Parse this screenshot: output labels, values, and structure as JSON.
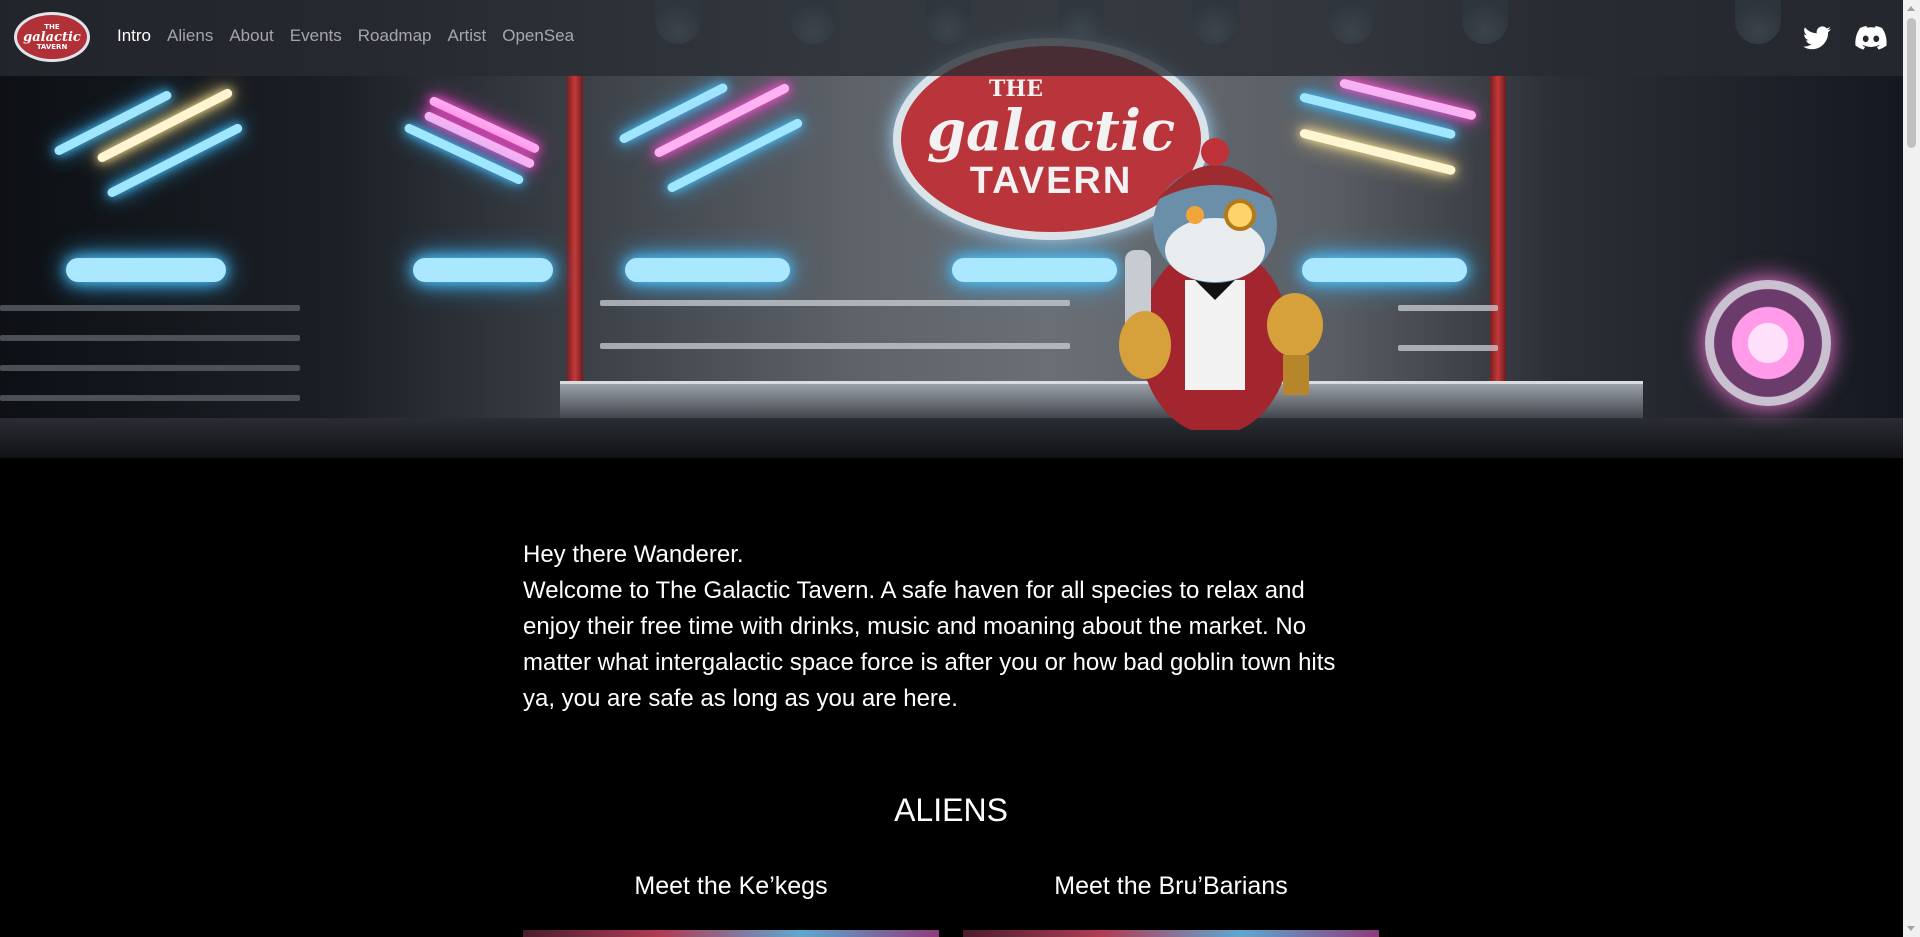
{
  "logo": {
    "line1": "THE",
    "line2": "galactic",
    "line3": "TAVERN"
  },
  "nav": {
    "items": [
      {
        "label": "Intro",
        "active": true
      },
      {
        "label": "Aliens",
        "active": false
      },
      {
        "label": "About",
        "active": false
      },
      {
        "label": "Events",
        "active": false
      },
      {
        "label": "Roadmap",
        "active": false
      },
      {
        "label": "Artist",
        "active": false
      },
      {
        "label": "OpenSea",
        "active": false
      }
    ],
    "social": [
      {
        "icon": "twitter-icon"
      },
      {
        "icon": "discord-icon"
      }
    ]
  },
  "hero": {
    "sign": {
      "line1": "THE",
      "line2": "galactic",
      "line3": "TAVERN"
    }
  },
  "intro": {
    "greeting": "Hey there Wanderer.",
    "body": "Welcome to The Galactic Tavern. A safe haven for all species to relax and enjoy their free time with drinks, music and moaning about the market. No matter what intergalactic space force is after you or how bad goblin town hits ya, you are safe as long as you are here."
  },
  "aliens": {
    "title": "ALIENS",
    "cards": [
      {
        "title": "Meet the Ke’kegs"
      },
      {
        "title": "Meet the Bru’Barians"
      }
    ]
  },
  "colors": {
    "background": "#000000",
    "nav": "#2c3036",
    "sign_red": "#b9343b",
    "neon_blue": "#9fe6ff",
    "neon_pink": "#ffb2f3"
  }
}
